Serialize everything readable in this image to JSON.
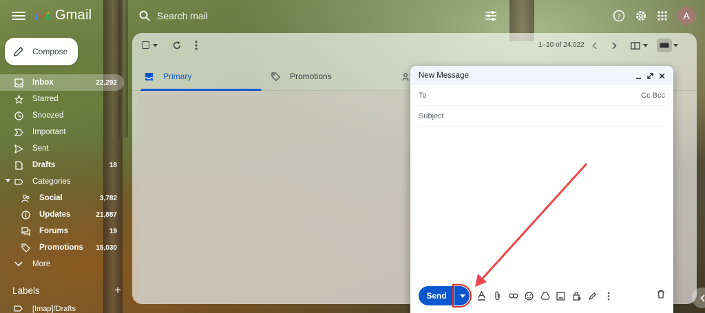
{
  "app": {
    "name": "Gmail"
  },
  "search": {
    "placeholder": "Search mail"
  },
  "account": {
    "initial": "A"
  },
  "compose_button": {
    "label": "Compose"
  },
  "nav": {
    "items": [
      {
        "label": "Inbox",
        "count": "22,292",
        "icon": "inbox-icon"
      },
      {
        "label": "Starred",
        "count": "",
        "icon": "star-icon"
      },
      {
        "label": "Snoozed",
        "count": "",
        "icon": "clock-icon"
      },
      {
        "label": "Important",
        "count": "",
        "icon": "important-icon"
      },
      {
        "label": "Sent",
        "count": "",
        "icon": "send-icon"
      },
      {
        "label": "Drafts",
        "count": "18",
        "icon": "draft-icon"
      },
      {
        "label": "Categories",
        "count": "",
        "icon": "label-icon"
      },
      {
        "label": "Social",
        "count": "3,782",
        "icon": "people-icon"
      },
      {
        "label": "Updates",
        "count": "21,887",
        "icon": "info-icon"
      },
      {
        "label": "Forums",
        "count": "19",
        "icon": "forum-icon"
      },
      {
        "label": "Promotions",
        "count": "15,030",
        "icon": "tag-icon"
      },
      {
        "label": "More",
        "count": "",
        "icon": "chevron-down-icon"
      }
    ]
  },
  "labels": {
    "title": "Labels",
    "first_item": "[Imap]/Drafts"
  },
  "toolbar": {
    "pager": "1–10 of 24,022"
  },
  "tabs": [
    {
      "label": "Primary"
    },
    {
      "label": "Promotions"
    }
  ],
  "compose_window": {
    "title": "New Message",
    "to_label": "To",
    "cc_bcc": "Cc Bcc",
    "subject_placeholder": "Subject",
    "send_label": "Send"
  },
  "colors": {
    "accent": "#0b57d0",
    "highlight": "#d93025",
    "annotation_arrow": "#e8474c"
  }
}
